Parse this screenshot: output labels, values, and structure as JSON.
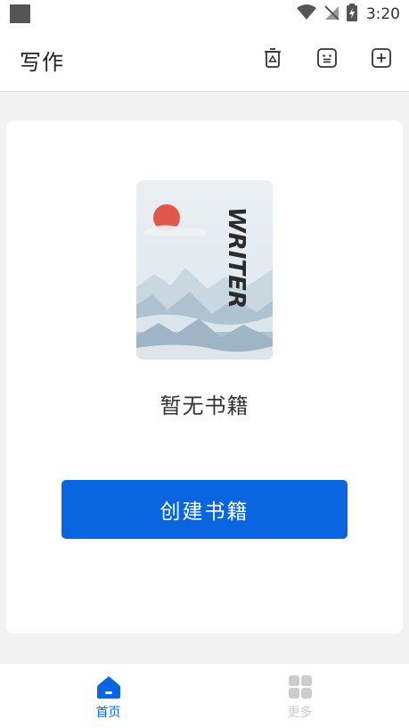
{
  "status_bar": {
    "time": "3:20"
  },
  "app_bar": {
    "title": "写作",
    "actions": [
      "recycle-bin-icon",
      "emoji-face-icon",
      "add-icon"
    ]
  },
  "main": {
    "cover_text": "WRITER",
    "empty_text": "暂无书籍",
    "create_button_label": "创建书籍"
  },
  "bottom_nav": {
    "items": [
      {
        "label": "首页",
        "icon": "home-icon",
        "active": true
      },
      {
        "label": "更多",
        "icon": "grid-icon",
        "active": false
      }
    ]
  },
  "colors": {
    "accent": "#0a66e0",
    "inactive": "#cccccc",
    "background": "#f2f2f2"
  }
}
